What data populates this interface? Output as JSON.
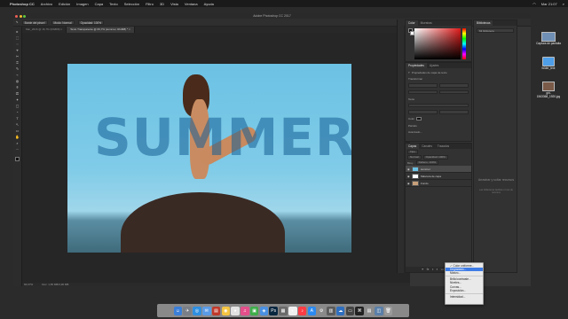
{
  "menubar": {
    "app_name": "Photoshop CC",
    "menus": [
      "Archivo",
      "Edición",
      "Imagen",
      "Capa",
      "Texto",
      "Selección",
      "Filtro",
      "3D",
      "Vista",
      "Ventana",
      "Ayuda"
    ],
    "clock": "Mar 21:07"
  },
  "window": {
    "title": "Adobe Photoshop CC 2017"
  },
  "options_bar": {
    "tool_preset": "Borde del pincel",
    "mode": "Modo: Normal",
    "opacity": "Opacidad: 100%"
  },
  "doc_tabs": [
    {
      "label": "Mar_2016 @ 16,7% (RGB/8) ×",
      "active": false
    },
    {
      "label": "Texto Transparente @ 66,7% (summer, RGB/8) * ×",
      "active": true
    }
  ],
  "tools": [
    "▸",
    "⬚",
    "◌",
    "⌖",
    "✂",
    "⌗",
    "✎",
    "⌁",
    "◍",
    "⍟",
    "⎚",
    "✦",
    "▢",
    "◔",
    "T",
    "↖",
    "▭",
    "✋",
    "⌕",
    "⋯"
  ],
  "document": {
    "overlay_text": "SUMMER"
  },
  "status_bar": {
    "zoom": "66,67%",
    "doc_info": "Doc: 1,65 MB/3,96 MB"
  },
  "color_panel": {
    "tabs": [
      "Color",
      "Muestras"
    ],
    "colors": {
      "red": "#e01b1b"
    }
  },
  "properties_panel": {
    "tabs": [
      "Propiedades",
      "Ajustes"
    ],
    "header": "Propiedades de capa de texto",
    "rows": [
      "Transformar",
      "Texto",
      "Párrafo",
      "Color"
    ],
    "link_label": "Avanzado..."
  },
  "layers_panel": {
    "tabs": [
      "Capas",
      "Canales",
      "Trazados"
    ],
    "kind_filter": "Tipo",
    "blend_mode": "Normal",
    "opacity": "Opacidad: 100%",
    "lock_label": "Bloq.:",
    "fill": "Relleno: 100%",
    "layers": [
      {
        "name": "summer",
        "selected": true
      },
      {
        "name": "Máscara de capa",
        "selected": false
      },
      {
        "name": "Fondo",
        "selected": false
      }
    ],
    "footer_icons": [
      "link-icon",
      "fx-icon",
      "mask-icon",
      "adjustment-icon",
      "folder-icon",
      "new-layer-icon",
      "trash-icon"
    ]
  },
  "libraries_panel": {
    "title": "Bibliotecas",
    "search_placeholder": "Mi biblioteca",
    "empty_title": "Arrastrar y soltar recursos",
    "empty_sub": "Las bibliotecas facilitan el uso de recursos"
  },
  "context_menu": {
    "items": [
      {
        "label": "✓ Color uniforme...",
        "highlight": false
      },
      {
        "label": "Degradado...",
        "highlight": true
      },
      {
        "label": "Motivo...",
        "highlight": false
      },
      {
        "sep": true
      },
      {
        "label": "Brillo/contraste...",
        "highlight": false
      },
      {
        "label": "Niveles...",
        "highlight": false
      },
      {
        "label": "Curvas...",
        "highlight": false
      },
      {
        "label": "Exposición...",
        "highlight": false
      },
      {
        "sep": true
      },
      {
        "label": "Intensidad...",
        "highlight": false
      }
    ]
  },
  "desktop_icons": [
    {
      "label": "Captura de pantalla",
      "color": "#6f8fb5"
    },
    {
      "label": "folder_text",
      "color": "#4e9ee8"
    },
    {
      "label": "girl-1563368_1920.jpg",
      "color": "#7a5a48"
    }
  ],
  "dock": [
    {
      "glyph": "☺",
      "color": "#3b7fd8"
    },
    {
      "glyph": "✈",
      "color": "#7a7f87"
    },
    {
      "glyph": "◎",
      "color": "#2f8fe0"
    },
    {
      "glyph": "✉",
      "color": "#5a9be6"
    },
    {
      "glyph": "▤",
      "color": "#c0392b"
    },
    {
      "glyph": "◉",
      "color": "#f5c542"
    },
    {
      "glyph": "●",
      "color": "#e2e2e2"
    },
    {
      "glyph": "♫",
      "color": "#e34f8a"
    },
    {
      "glyph": "▣",
      "color": "#3fae4a"
    },
    {
      "glyph": "◈",
      "color": "#4a90e2"
    },
    {
      "glyph": "Ps",
      "color": "#0a2740"
    },
    {
      "glyph": "▦",
      "color": "#6a6a6a"
    },
    {
      "glyph": "◐",
      "color": "#f0f0f0"
    },
    {
      "glyph": "♪",
      "color": "#fc3c44"
    },
    {
      "glyph": "A",
      "color": "#2b8af0"
    },
    {
      "glyph": "⚙",
      "color": "#8a8a8a"
    },
    {
      "glyph": "▥",
      "color": "#5b5b5b"
    },
    {
      "glyph": "☁",
      "color": "#2f6fbf"
    },
    {
      "glyph": "▭",
      "color": "#444"
    },
    {
      "glyph": "⌘",
      "color": "#222"
    },
    {
      "glyph": "▤",
      "color": "#8c8c8c"
    },
    {
      "glyph": "◫",
      "color": "#5a7fa8"
    },
    {
      "glyph": "🗑",
      "color": "#9a9a9a"
    }
  ]
}
